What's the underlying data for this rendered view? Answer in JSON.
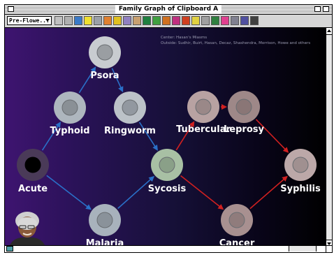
{
  "window": {
    "title": "Family Graph of Clipboard A"
  },
  "toolbar": {
    "menu_label": "Pre-Flowe...",
    "tools": [
      {
        "name": "select-tool-icon",
        "color": "#c0c0c0"
      },
      {
        "name": "grid-tool-icon",
        "color": "#b0b0b0"
      },
      {
        "name": "globe-tool-icon",
        "color": "#3a7ac8"
      },
      {
        "name": "bulb-tool-icon",
        "color": "#f0e030"
      },
      {
        "name": "box-tool-icon",
        "color": "#9aa0a8"
      },
      {
        "name": "flower-tool-icon",
        "color": "#e08030"
      },
      {
        "name": "star-tool-icon",
        "color": "#e0c020"
      },
      {
        "name": "rotate-tool-icon",
        "color": "#9080c0"
      },
      {
        "name": "figure-tool-icon",
        "color": "#c8a070"
      },
      {
        "name": "tree-tool-icon",
        "color": "#208040"
      },
      {
        "name": "leaf-tool-icon",
        "color": "#40a040"
      },
      {
        "name": "pot-tool-icon",
        "color": "#d07020"
      },
      {
        "name": "flower2-tool-icon",
        "color": "#c03080"
      },
      {
        "name": "stamp-tool-icon",
        "color": "#d04020"
      },
      {
        "name": "hand-tool-icon",
        "color": "#e0d040"
      },
      {
        "name": "back-tool-icon",
        "color": "#a0a0a0"
      },
      {
        "name": "elephant-tool-icon",
        "color": "#308040"
      },
      {
        "name": "heart-tool-icon",
        "color": "#e04090"
      },
      {
        "name": "lines-tool-icon",
        "color": "#808090"
      },
      {
        "name": "cross-tool-icon",
        "color": "#5050a0"
      },
      {
        "name": "asterisk-tool-icon",
        "color": "#404040"
      }
    ]
  },
  "graph": {
    "info_line1": "Center: Hasan's Miasms",
    "info_line2": "Outside: Sudhir, Buirt, Hasan, Decaz, Shashendra, Morrison, Howe and others",
    "colors": {
      "blue_edge": "#2a70c8",
      "red_edge": "#d02020"
    },
    "nodes": [
      {
        "id": "psora",
        "label": "Psora",
        "outer": "#c8ccd0",
        "inner": "#9a9ea2"
      },
      {
        "id": "typhoid",
        "label": "Typhoid",
        "outer": "#aeb6be",
        "inner": "#8a9096"
      },
      {
        "id": "ringworm",
        "label": "Ringworm",
        "outer": "#bcc2c8",
        "inner": "#9298a0"
      },
      {
        "id": "tubercular",
        "label": "Tubercular",
        "outer": "#b8a2a2",
        "inner": "#9a8888"
      },
      {
        "id": "leprosy",
        "label": "Leprosy",
        "outer": "#9e8888",
        "inner": "#8a7676"
      },
      {
        "id": "acute",
        "label": "Acute",
        "outer": "#4a3a58",
        "inner": "#000000"
      },
      {
        "id": "sycosis",
        "label": "Sycosis",
        "outer": "#a8c0a4",
        "inner": "#8aa088"
      },
      {
        "id": "syphilis",
        "label": "Syphilis",
        "outer": "#bca8a8",
        "inner": "#a09090"
      },
      {
        "id": "malaria",
        "label": "Malaria",
        "outer": "#a8b2bc",
        "inner": "#8a929a"
      },
      {
        "id": "cancer",
        "label": "Cancer",
        "outer": "#a89090",
        "inner": "#907c7c"
      }
    ]
  }
}
